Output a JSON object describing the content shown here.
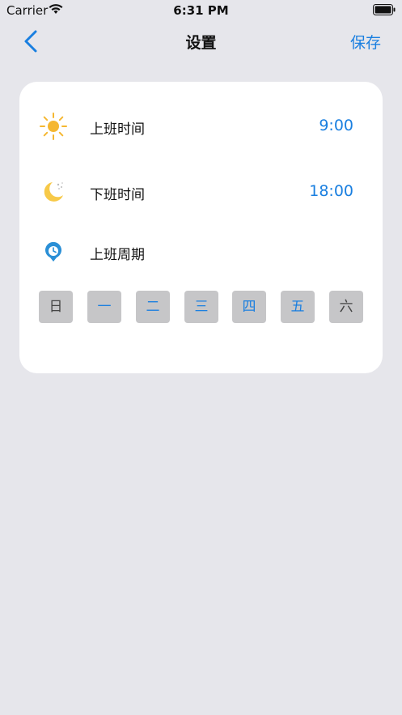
{
  "status_bar": {
    "carrier": "Carrier",
    "time": "6:31 PM"
  },
  "nav": {
    "title": "设置",
    "save_label": "保存"
  },
  "settings": {
    "start_work": {
      "label": "上班时间",
      "value": "9:00",
      "icon": "sun-icon"
    },
    "end_work": {
      "label": "下班时间",
      "value": "18:00",
      "icon": "moon-icon"
    },
    "work_cycle": {
      "label": "上班周期",
      "icon": "clock-icon"
    }
  },
  "weekdays": [
    {
      "label": "日",
      "selected": false
    },
    {
      "label": "一",
      "selected": true
    },
    {
      "label": "二",
      "selected": true
    },
    {
      "label": "三",
      "selected": true
    },
    {
      "label": "四",
      "selected": true
    },
    {
      "label": "五",
      "selected": true
    },
    {
      "label": "六",
      "selected": false
    }
  ],
  "colors": {
    "accent": "#1a7fe0",
    "background": "#e6e6eb",
    "day_button": "#c6c6c8",
    "sun": "#f5b731",
    "moon": "#f7c948"
  }
}
